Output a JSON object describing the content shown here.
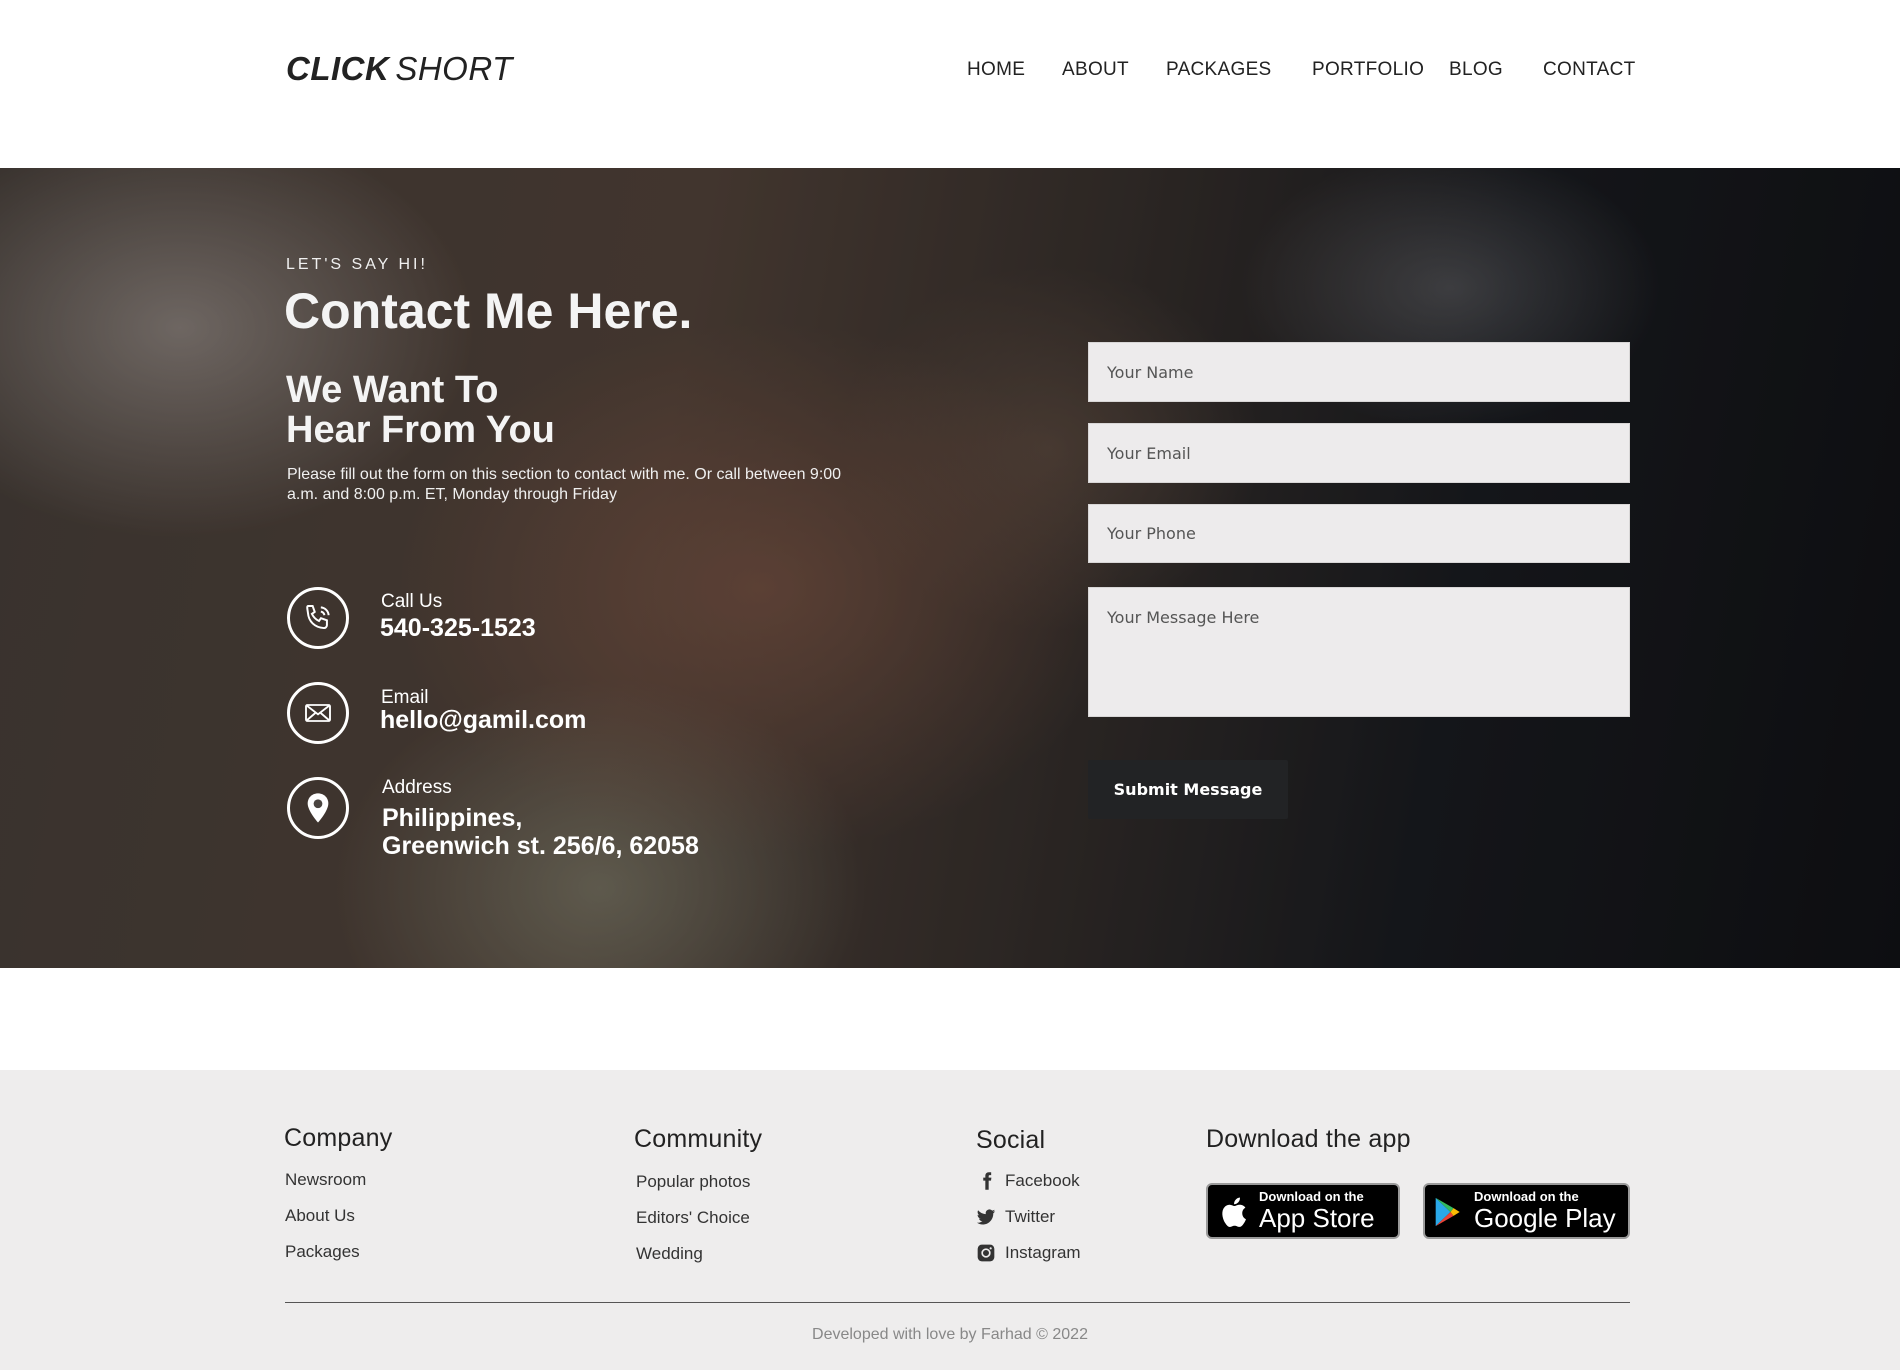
{
  "header": {
    "logo_bold": "CLICK",
    "logo_light": "SHORT",
    "nav": [
      "HOME",
      "ABOUT",
      "PACKAGES",
      "PORTFOLIO",
      "BLOG",
      "CONTACT"
    ]
  },
  "hero": {
    "eyebrow": "LET'S SAY HI!",
    "title": "Contact Me Here.",
    "subtitle_line1": "We Want To",
    "subtitle_line2": "Hear From You",
    "description": "Please fill out the form on this section to contact with me. Or call between 9:00 a.m. and 8:00 p.m. ET, Monday through Friday",
    "contacts": {
      "phone": {
        "label": "Call Us",
        "value": "540-325-1523",
        "icon": "phone-icon"
      },
      "email": {
        "label": "Email",
        "value": "hello@gamil.com",
        "icon": "envelope-icon"
      },
      "address": {
        "label": "Address",
        "line1": "Philippines,",
        "line2": "Greenwich st. 256/6, 62058",
        "icon": "location-pin-icon"
      }
    }
  },
  "form": {
    "name_placeholder": "Your Name",
    "email_placeholder": "Your Email",
    "phone_placeholder": "Your Phone",
    "message_placeholder": "Your Message Here",
    "submit_label": "Submit Message"
  },
  "footer": {
    "company": {
      "heading": "Company",
      "links": [
        "Newsroom",
        "About Us",
        "Packages"
      ]
    },
    "community": {
      "heading": "Community",
      "links": [
        "Popular photos",
        "Editors' Choice",
        "Wedding"
      ]
    },
    "social": {
      "heading": "Social",
      "links": [
        "Facebook",
        "Twitter",
        "Instagram"
      ]
    },
    "app": {
      "heading": "Download the app",
      "app_store_small": "Download on the",
      "app_store_big": "App Store",
      "google_play_small": "Download on the",
      "google_play_big": "Google Play"
    },
    "copyright": "Developed with love by Farhad © 2022"
  }
}
